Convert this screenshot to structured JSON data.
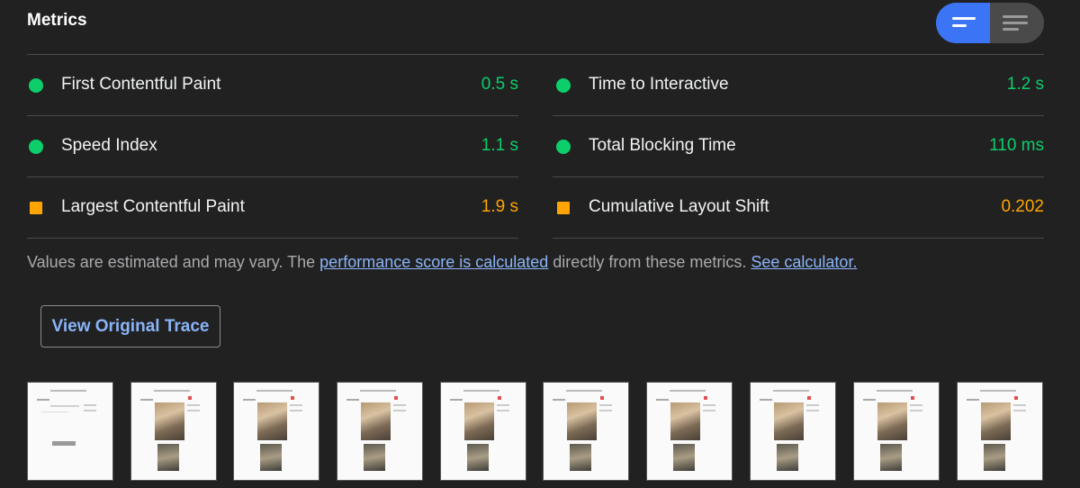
{
  "header": {
    "title": "Metrics",
    "view_toggle": {
      "active": "list-view",
      "inactive": "table-view"
    }
  },
  "metrics": {
    "left": [
      {
        "label": "First Contentful Paint",
        "value": "0.5 s",
        "rating": "good"
      },
      {
        "label": "Speed Index",
        "value": "1.1 s",
        "rating": "good"
      },
      {
        "label": "Largest Contentful Paint",
        "value": "1.9 s",
        "rating": "average"
      }
    ],
    "right": [
      {
        "label": "Time to Interactive",
        "value": "1.2 s",
        "rating": "good"
      },
      {
        "label": "Total Blocking Time",
        "value": "110 ms",
        "rating": "good"
      },
      {
        "label": "Cumulative Layout Shift",
        "value": "0.202",
        "rating": "average"
      }
    ]
  },
  "note": {
    "prefix": "Values are estimated and may vary. The ",
    "link1": "performance score is calculated",
    "middle": " directly from these metrics.",
    "link2": "See calculator."
  },
  "trace_button": {
    "label": "View Original Trace"
  },
  "filmstrip": {
    "frame_count": 10
  },
  "colors": {
    "good": "#0cce6b",
    "average": "#ffa400",
    "accent": "#3b74f5",
    "link": "#8ab4f8"
  }
}
